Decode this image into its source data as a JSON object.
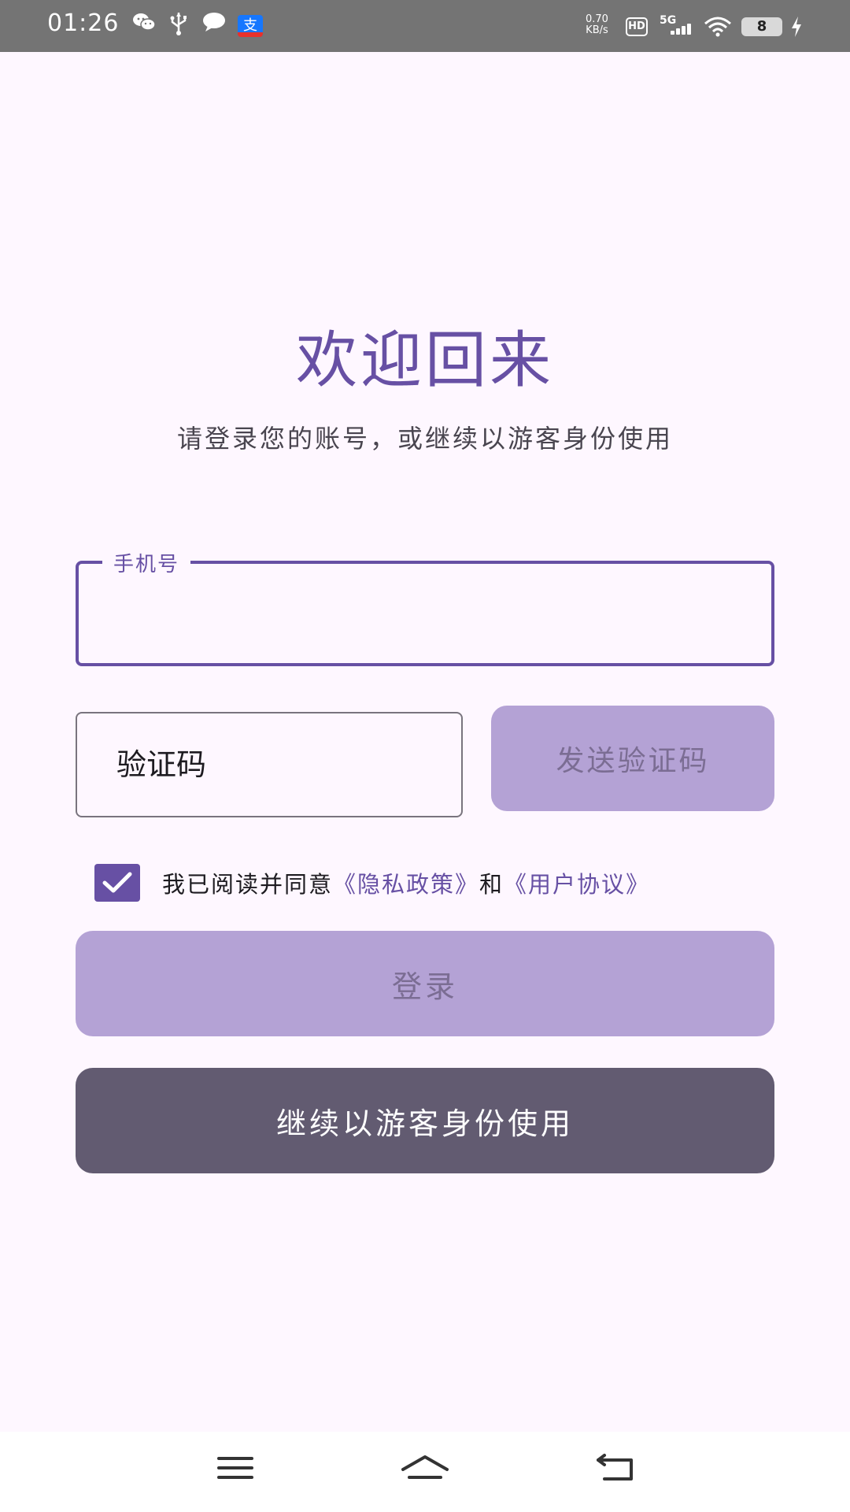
{
  "status_bar": {
    "time": "01:26",
    "speed_value": "0.70",
    "speed_unit": "KB/s",
    "hd": "HD",
    "network": "5G",
    "battery": "8",
    "alipay_glyph": "支",
    "icons": [
      "wechat-icon",
      "usb-icon",
      "message-icon",
      "alipay-icon",
      "signal-icon",
      "wifi-icon",
      "battery-icon",
      "charging-icon"
    ]
  },
  "header": {
    "title": "欢迎回来",
    "subtitle": "请登录您的账号，或继续以游客身份使用"
  },
  "form": {
    "phone_label": "手机号",
    "phone_value": "",
    "code_placeholder": "验证码",
    "code_value": "",
    "send_code_label": "发送验证码",
    "agree_checked": true,
    "agree_text": "我已阅读并同意",
    "privacy_link": "《隐私政策》",
    "and_text": "和",
    "terms_link": "《用户协议》",
    "login_label": "登录",
    "guest_label": "继续以游客身份使用"
  },
  "nav_bar": {
    "icons": [
      "menu-icon",
      "home-icon",
      "back-icon"
    ]
  },
  "colors": {
    "primary": "#6750a4",
    "disabled_button": "#b4a2d5",
    "secondary_button": "#625b71",
    "background": "#fef7ff"
  }
}
